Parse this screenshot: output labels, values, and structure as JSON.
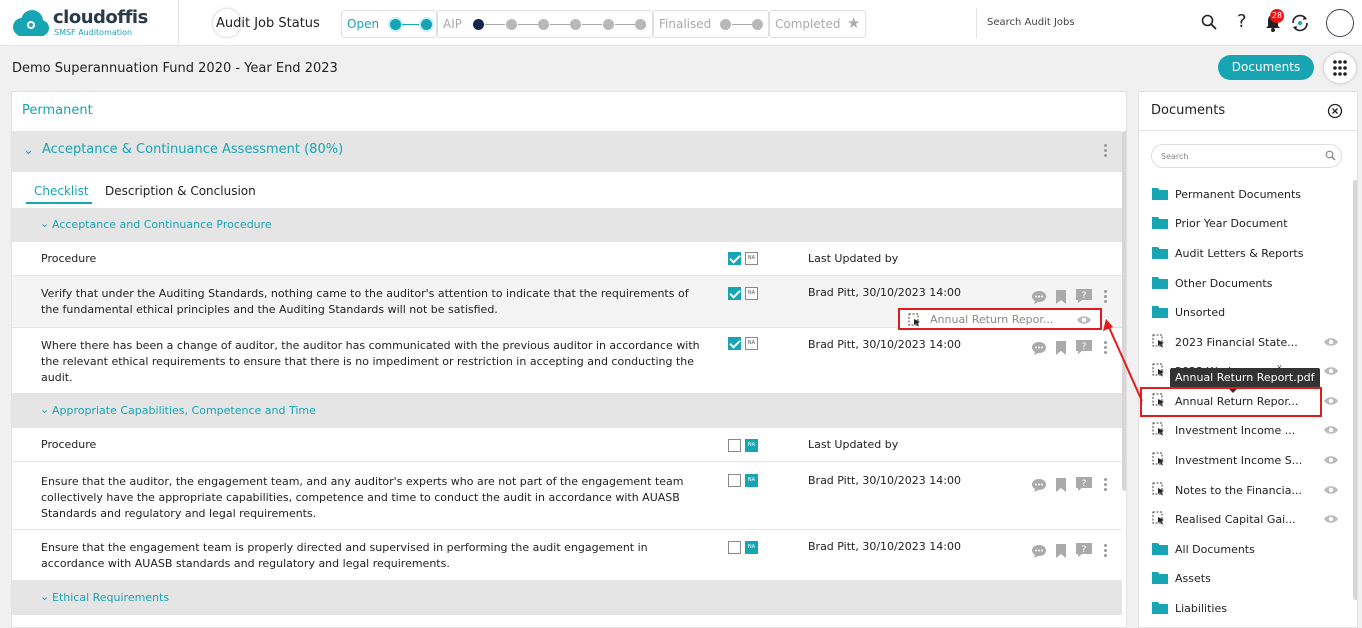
{
  "app": {
    "brand": "cloudoffis",
    "tagline": "SMSF Auditomation",
    "section_title": "Audit Job Status"
  },
  "stages": [
    {
      "label": "Open",
      "active": true
    },
    {
      "label": "AIP",
      "active": false
    },
    {
      "label": "Finalised",
      "active": false
    },
    {
      "label": "Completed",
      "active": false
    }
  ],
  "header": {
    "search_placeholder": "Search Audit Jobs",
    "help": "?",
    "notification_count": "28"
  },
  "page": {
    "title": "Demo Superannuation Fund 2020 - Year End 2023",
    "documents_button": "Documents"
  },
  "main": {
    "group": "Permanent",
    "section": "Acceptance & Continuance Assessment (80%)",
    "tabs": [
      "Checklist",
      "Description & Conclusion"
    ],
    "subsections": [
      "Acceptance and Continuance Procedure",
      "Appropriate Capabilities, Competence and Time",
      "Ethical Requirements"
    ],
    "col_procedure": "Procedure",
    "col_last_updated": "Last Updated by",
    "na_label": "NA",
    "rows": [
      {
        "text": "Verify that under the Auditing Standards, nothing came to the auditor's attention to indicate that the requirements of the fundamental ethical principles and the Auditing Standards will not be satisfied.",
        "updated": "Brad Pitt, 30/10/2023 14:00"
      },
      {
        "text": "Where there has been a change of auditor, the auditor has communicated with the previous auditor in accordance with the relevant ethical requirements to ensure that there is no impediment or restriction in accepting and conducting the audit.",
        "updated": "Brad Pitt, 30/10/2023 14:00"
      },
      {
        "text": "Ensure that the auditor, the engagement team, and any auditor's experts who are not part of the engagement team collectively have the appropriate capabilities, competence and time to conduct the audit in accordance with AUASB Standards and regulatory and legal requirements.",
        "updated": "Brad Pitt, 30/10/2023 14:00"
      },
      {
        "text": "Ensure that the engagement team is properly directed and supervised in performing the audit engagement in accordance with AUASB  standards and regulatory and legal requirements.",
        "updated": "Brad Pitt, 30/10/2023 14:00"
      }
    ],
    "attached_file": "Annual Return Repor..."
  },
  "documents": {
    "title": "Documents",
    "search_placeholder": "Search",
    "items": [
      {
        "label": "Permanent Documents",
        "type": "folder"
      },
      {
        "label": "Prior Year Document",
        "type": "folder"
      },
      {
        "label": "Audit Letters & Reports",
        "type": "folder"
      },
      {
        "label": "Other Documents",
        "type": "folder"
      },
      {
        "label": "Unsorted",
        "type": "folder"
      },
      {
        "label": "2023 Financial State...",
        "type": "file"
      },
      {
        "label": "2023 Workpapers Ä...",
        "type": "file"
      },
      {
        "label": "Annual Return Repor...",
        "type": "file"
      },
      {
        "label": "Investment Income ...",
        "type": "file"
      },
      {
        "label": "Investment Income S...",
        "type": "file"
      },
      {
        "label": "Notes to the Financia...",
        "type": "file"
      },
      {
        "label": "Realised Capital Gai...",
        "type": "file"
      },
      {
        "label": "All Documents",
        "type": "folder"
      },
      {
        "label": "Assets",
        "type": "folder"
      },
      {
        "label": "Liabilities",
        "type": "folder"
      }
    ],
    "tooltip": "Annual Return Report.pdf"
  },
  "colors": {
    "accent": "#17a5b4",
    "navy": "#13254a",
    "highlight": "#e21b1b"
  }
}
